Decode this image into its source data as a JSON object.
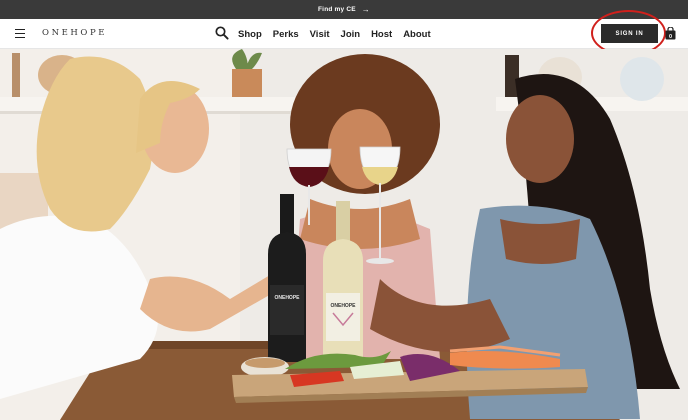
{
  "announcement": {
    "text": "Find my CE",
    "arrow_icon": "arrow-right-icon"
  },
  "header": {
    "logo": "ONEHOPE",
    "nav": [
      {
        "label": "Shop"
      },
      {
        "label": "Perks"
      },
      {
        "label": "Visit"
      },
      {
        "label": "Join"
      },
      {
        "label": "Host"
      },
      {
        "label": "About"
      }
    ],
    "signin_label": "SIGN IN",
    "icons": {
      "menu": "hamburger-menu-icon",
      "search": "search-icon",
      "cart": "shopping-bag-icon"
    },
    "highlight_color": "#d0201c"
  },
  "hero": {
    "image": "three-women-toasting-wine-at-table",
    "bottle_left_label": "ONEHOPE",
    "bottle_right_label": "ONEHOPE",
    "colors": {
      "wall": "#efece8",
      "table": "#8a5a36",
      "board": "#c9a57a"
    }
  }
}
